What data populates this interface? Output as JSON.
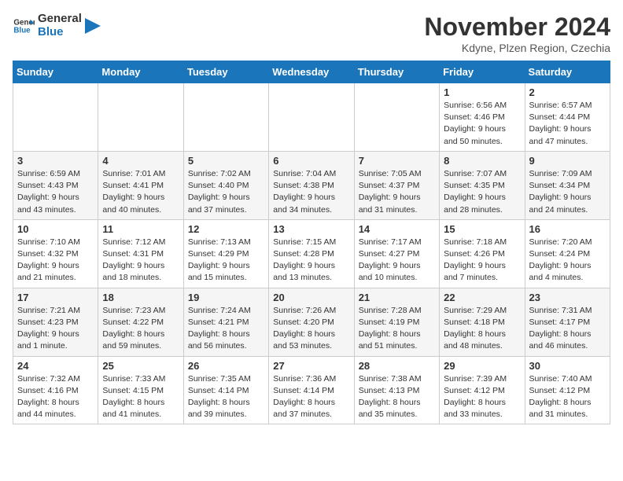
{
  "logo": {
    "text_general": "General",
    "text_blue": "Blue"
  },
  "title": "November 2024",
  "subtitle": "Kdyne, Plzen Region, Czechia",
  "days_of_week": [
    "Sunday",
    "Monday",
    "Tuesday",
    "Wednesday",
    "Thursday",
    "Friday",
    "Saturday"
  ],
  "weeks": [
    [
      {
        "day": "",
        "info": ""
      },
      {
        "day": "",
        "info": ""
      },
      {
        "day": "",
        "info": ""
      },
      {
        "day": "",
        "info": ""
      },
      {
        "day": "",
        "info": ""
      },
      {
        "day": "1",
        "info": "Sunrise: 6:56 AM\nSunset: 4:46 PM\nDaylight: 9 hours\nand 50 minutes."
      },
      {
        "day": "2",
        "info": "Sunrise: 6:57 AM\nSunset: 4:44 PM\nDaylight: 9 hours\nand 47 minutes."
      }
    ],
    [
      {
        "day": "3",
        "info": "Sunrise: 6:59 AM\nSunset: 4:43 PM\nDaylight: 9 hours\nand 43 minutes."
      },
      {
        "day": "4",
        "info": "Sunrise: 7:01 AM\nSunset: 4:41 PM\nDaylight: 9 hours\nand 40 minutes."
      },
      {
        "day": "5",
        "info": "Sunrise: 7:02 AM\nSunset: 4:40 PM\nDaylight: 9 hours\nand 37 minutes."
      },
      {
        "day": "6",
        "info": "Sunrise: 7:04 AM\nSunset: 4:38 PM\nDaylight: 9 hours\nand 34 minutes."
      },
      {
        "day": "7",
        "info": "Sunrise: 7:05 AM\nSunset: 4:37 PM\nDaylight: 9 hours\nand 31 minutes."
      },
      {
        "day": "8",
        "info": "Sunrise: 7:07 AM\nSunset: 4:35 PM\nDaylight: 9 hours\nand 28 minutes."
      },
      {
        "day": "9",
        "info": "Sunrise: 7:09 AM\nSunset: 4:34 PM\nDaylight: 9 hours\nand 24 minutes."
      }
    ],
    [
      {
        "day": "10",
        "info": "Sunrise: 7:10 AM\nSunset: 4:32 PM\nDaylight: 9 hours\nand 21 minutes."
      },
      {
        "day": "11",
        "info": "Sunrise: 7:12 AM\nSunset: 4:31 PM\nDaylight: 9 hours\nand 18 minutes."
      },
      {
        "day": "12",
        "info": "Sunrise: 7:13 AM\nSunset: 4:29 PM\nDaylight: 9 hours\nand 15 minutes."
      },
      {
        "day": "13",
        "info": "Sunrise: 7:15 AM\nSunset: 4:28 PM\nDaylight: 9 hours\nand 13 minutes."
      },
      {
        "day": "14",
        "info": "Sunrise: 7:17 AM\nSunset: 4:27 PM\nDaylight: 9 hours\nand 10 minutes."
      },
      {
        "day": "15",
        "info": "Sunrise: 7:18 AM\nSunset: 4:26 PM\nDaylight: 9 hours\nand 7 minutes."
      },
      {
        "day": "16",
        "info": "Sunrise: 7:20 AM\nSunset: 4:24 PM\nDaylight: 9 hours\nand 4 minutes."
      }
    ],
    [
      {
        "day": "17",
        "info": "Sunrise: 7:21 AM\nSunset: 4:23 PM\nDaylight: 9 hours\nand 1 minute."
      },
      {
        "day": "18",
        "info": "Sunrise: 7:23 AM\nSunset: 4:22 PM\nDaylight: 8 hours\nand 59 minutes."
      },
      {
        "day": "19",
        "info": "Sunrise: 7:24 AM\nSunset: 4:21 PM\nDaylight: 8 hours\nand 56 minutes."
      },
      {
        "day": "20",
        "info": "Sunrise: 7:26 AM\nSunset: 4:20 PM\nDaylight: 8 hours\nand 53 minutes."
      },
      {
        "day": "21",
        "info": "Sunrise: 7:28 AM\nSunset: 4:19 PM\nDaylight: 8 hours\nand 51 minutes."
      },
      {
        "day": "22",
        "info": "Sunrise: 7:29 AM\nSunset: 4:18 PM\nDaylight: 8 hours\nand 48 minutes."
      },
      {
        "day": "23",
        "info": "Sunrise: 7:31 AM\nSunset: 4:17 PM\nDaylight: 8 hours\nand 46 minutes."
      }
    ],
    [
      {
        "day": "24",
        "info": "Sunrise: 7:32 AM\nSunset: 4:16 PM\nDaylight: 8 hours\nand 44 minutes."
      },
      {
        "day": "25",
        "info": "Sunrise: 7:33 AM\nSunset: 4:15 PM\nDaylight: 8 hours\nand 41 minutes."
      },
      {
        "day": "26",
        "info": "Sunrise: 7:35 AM\nSunset: 4:14 PM\nDaylight: 8 hours\nand 39 minutes."
      },
      {
        "day": "27",
        "info": "Sunrise: 7:36 AM\nSunset: 4:14 PM\nDaylight: 8 hours\nand 37 minutes."
      },
      {
        "day": "28",
        "info": "Sunrise: 7:38 AM\nSunset: 4:13 PM\nDaylight: 8 hours\nand 35 minutes."
      },
      {
        "day": "29",
        "info": "Sunrise: 7:39 AM\nSunset: 4:12 PM\nDaylight: 8 hours\nand 33 minutes."
      },
      {
        "day": "30",
        "info": "Sunrise: 7:40 AM\nSunset: 4:12 PM\nDaylight: 8 hours\nand 31 minutes."
      }
    ]
  ]
}
